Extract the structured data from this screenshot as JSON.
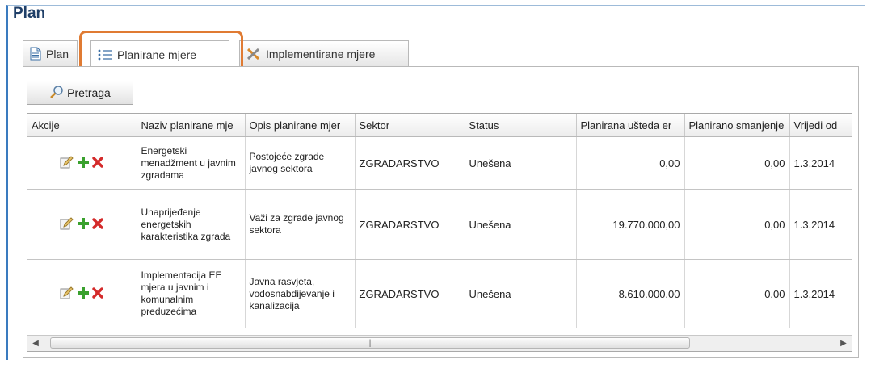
{
  "page": {
    "title": "Plan"
  },
  "tabs": [
    {
      "label": "Plan",
      "icon": "document-icon"
    },
    {
      "label": "Planirane mjere",
      "icon": "list-icon",
      "active": true
    },
    {
      "label": "Implementirane mjere",
      "icon": "tools-icon"
    }
  ],
  "toolbar": {
    "search_label": "Pretraga",
    "search_icon": "magnifier-icon"
  },
  "grid": {
    "columns": [
      "Akcije",
      "Naziv planirane mje",
      "Opis planirane mjer",
      "Sektor",
      "Status",
      "Planirana ušteda er",
      "Planirano smanjenje",
      "Vrijedi od"
    ],
    "rows": [
      {
        "naziv": "Energetski menadžment u javnim zgradama",
        "opis": "Postojeće zgrade javnog sektora",
        "sektor": "ZGRADARSTVO",
        "status": "Unešena",
        "usteda": "0,00",
        "smanjenje": "0,00",
        "vrijedi_od": "1.3.2014"
      },
      {
        "naziv": "Unaprijeđenje energetskih karakteristika zgrada",
        "opis": "Važi za zgrade javnog sektora",
        "sektor": "ZGRADARSTVO",
        "status": "Unešena",
        "usteda": "19.770.000,00",
        "smanjenje": "0,00",
        "vrijedi_od": "1.3.2014"
      },
      {
        "naziv": "Implementacija EE mjera u javnim i komunalnim preduzećima",
        "opis": "Javna rasvjeta, vodosnabdijevanje i kanalizacija",
        "sektor": "ZGRADARSTVO",
        "status": "Unešena",
        "usteda": "8.610.000,00",
        "smanjenje": "0,00",
        "vrijedi_od": "1.3.2014"
      }
    ]
  },
  "colors": {
    "title": "#1f3f68",
    "highlight": "#e07b33",
    "add": "#3aa12e",
    "delete": "#d42a2a"
  }
}
